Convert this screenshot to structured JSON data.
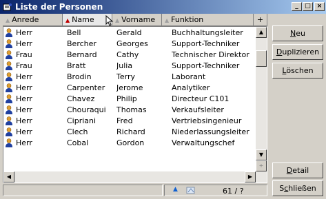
{
  "window": {
    "title": "Liste der Personen",
    "minimize": "_",
    "restore": "□",
    "close": "×"
  },
  "grid": {
    "columns": [
      {
        "label": "Anrede",
        "sorted": false
      },
      {
        "label": "Name",
        "sorted": true
      },
      {
        "label": "Vorname",
        "sorted": false
      },
      {
        "label": "Funktion",
        "sorted": false
      }
    ],
    "add_column_label": "+",
    "rows": [
      {
        "anrede": "Herr",
        "name": "Bell",
        "vorname": "Gerald",
        "funktion": "Buchhaltungsleiter"
      },
      {
        "anrede": "Herr",
        "name": "Bercher",
        "vorname": "Georges",
        "funktion": "Support-Techniker"
      },
      {
        "anrede": "Frau",
        "name": "Bernard",
        "vorname": "Cathy",
        "funktion": "Technischer Direktor"
      },
      {
        "anrede": "Frau",
        "name": "Bratt",
        "vorname": "Julia",
        "funktion": "Support-Techniker"
      },
      {
        "anrede": "Herr",
        "name": "Brodin",
        "vorname": "Terry",
        "funktion": "Laborant"
      },
      {
        "anrede": "Herr",
        "name": "Carpenter",
        "vorname": "Jerome",
        "funktion": "Analytiker"
      },
      {
        "anrede": "Herr",
        "name": "Chavez",
        "vorname": "Philip",
        "funktion": "Directeur C101"
      },
      {
        "anrede": "Herr",
        "name": "Chouraqui",
        "vorname": "Thomas",
        "funktion": "Verkaufsleiter"
      },
      {
        "anrede": "Herr",
        "name": "Cipriani",
        "vorname": "Fred",
        "funktion": "Vertriebsingenieur"
      },
      {
        "anrede": "Herr",
        "name": "Clech",
        "vorname": "Richard",
        "funktion": "Niederlassungsleiter"
      },
      {
        "anrede": "Herr",
        "name": "Cobal",
        "vorname": "Gordon",
        "funktion": "Verwaltungschef"
      }
    ]
  },
  "status": {
    "record_count": "61 / ?"
  },
  "buttons": {
    "neu": {
      "underline": "N",
      "rest": "eu"
    },
    "duplizieren": {
      "underline": "D",
      "rest": "uplizieren"
    },
    "loeschen": {
      "underline": "L",
      "rest": "öschen"
    },
    "detail": {
      "underline": "D",
      "rest": "etail"
    },
    "schliessen": {
      "pre": "S",
      "underline": "c",
      "rest": "hließen"
    }
  }
}
